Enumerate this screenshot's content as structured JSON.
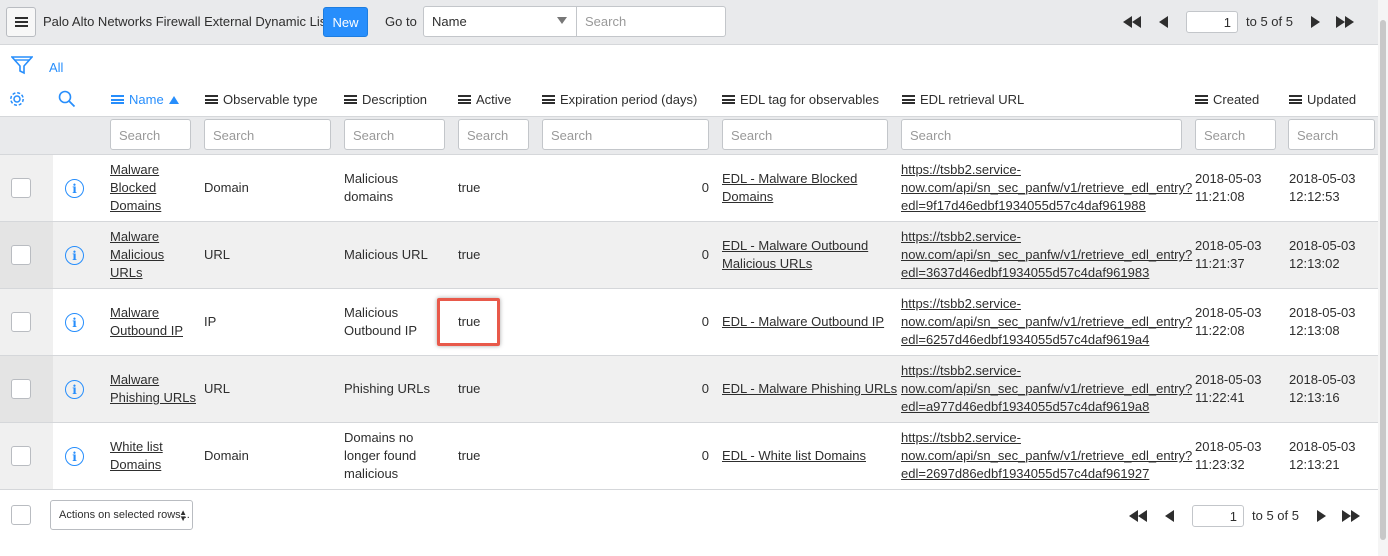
{
  "header": {
    "title": "Palo Alto Networks Firewall External Dynamic Lists",
    "new_label": "New",
    "goto_label": "Go to",
    "goto_select_value": "Name",
    "goto_search_placeholder": "Search",
    "pager": {
      "page": "1",
      "range_text": "to 5 of 5"
    }
  },
  "filter": {
    "label": "All"
  },
  "columns": [
    {
      "label": "Name",
      "sorted": true
    },
    {
      "label": "Observable type"
    },
    {
      "label": "Description"
    },
    {
      "label": "Active"
    },
    {
      "label": "Expiration period (days)"
    },
    {
      "label": "EDL tag for observables"
    },
    {
      "label": "EDL retrieval URL"
    },
    {
      "label": "Created"
    },
    {
      "label": "Updated"
    }
  ],
  "search_placeholder": "Search",
  "rows": [
    {
      "name_1": "Malware",
      "name_2": "Blocked",
      "name_3": "Domains",
      "type": "Domain",
      "desc_1": "Malicious",
      "desc_2": "domains",
      "desc_3": "",
      "active": "true",
      "expiration": "0",
      "tag_1": "EDL - Malware Blocked",
      "tag_2": "Domains",
      "url_1": "https://tsbb2.service-",
      "url_2": "now.com/api/sn_sec_panfw/v1/retrieve_edl_entry?",
      "url_3": "edl=9f17d46edbf1934055d57c4daf961988",
      "created_date": "2018-05-03",
      "created_time": "11:21:08",
      "updated_date": "2018-05-03",
      "updated_time": "12:12:53"
    },
    {
      "name_1": "Malware",
      "name_2": "Malicious",
      "name_3": "URLs",
      "type": "URL",
      "desc_1": "Malicious URL",
      "desc_2": "",
      "desc_3": "",
      "active": "true",
      "expiration": "0",
      "tag_1": "EDL - Malware Outbound",
      "tag_2": "Malicious URLs",
      "url_1": "https://tsbb2.service-",
      "url_2": "now.com/api/sn_sec_panfw/v1/retrieve_edl_entry?",
      "url_3": "edl=3637d46edbf1934055d57c4daf961983",
      "created_date": "2018-05-03",
      "created_time": "11:21:37",
      "updated_date": "2018-05-03",
      "updated_time": "12:13:02"
    },
    {
      "name_1": "Malware",
      "name_2": "Outbound IP",
      "name_3": "",
      "type": "IP",
      "desc_1": "Malicious",
      "desc_2": "Outbound IP",
      "desc_3": "",
      "active": "true",
      "expiration": "0",
      "tag_1": "EDL - Malware Outbound IP",
      "tag_2": "",
      "url_1": "https://tsbb2.service-",
      "url_2": "now.com/api/sn_sec_panfw/v1/retrieve_edl_entry?",
      "url_3": "edl=6257d46edbf1934055d57c4daf9619a4",
      "created_date": "2018-05-03",
      "created_time": "11:22:08",
      "updated_date": "2018-05-03",
      "updated_time": "12:13:08"
    },
    {
      "name_1": "Malware",
      "name_2": "Phishing URLs",
      "name_3": "",
      "type": "URL",
      "desc_1": "Phishing URLs",
      "desc_2": "",
      "desc_3": "",
      "active": "true",
      "expiration": "0",
      "tag_1": "EDL - Malware Phishing URLs",
      "tag_2": "",
      "url_1": "https://tsbb2.service-",
      "url_2": "now.com/api/sn_sec_panfw/v1/retrieve_edl_entry?",
      "url_3": "edl=a977d46edbf1934055d57c4daf9619a8",
      "created_date": "2018-05-03",
      "created_time": "11:22:41",
      "updated_date": "2018-05-03",
      "updated_time": "12:13:16"
    },
    {
      "name_1": "White list",
      "name_2": "Domains",
      "name_3": "",
      "type": "Domain",
      "desc_1": "Domains no",
      "desc_2": "longer found",
      "desc_3": "malicious",
      "active": "true",
      "expiration": "0",
      "tag_1": "EDL - White list Domains",
      "tag_2": "",
      "url_1": "https://tsbb2.service-",
      "url_2": "now.com/api/sn_sec_panfw/v1/retrieve_edl_entry?",
      "url_3": "edl=2697d86edbf1934055d57c4daf961927",
      "created_date": "2018-05-03",
      "created_time": "11:23:32",
      "updated_date": "2018-05-03",
      "updated_time": "12:13:21"
    }
  ],
  "footer": {
    "actions_label": "Actions on selected rows...",
    "pager": {
      "page": "1",
      "range_text": "to 5 of 5"
    }
  },
  "colors": {
    "accent": "#278efc",
    "highlight": "#e8594a"
  }
}
